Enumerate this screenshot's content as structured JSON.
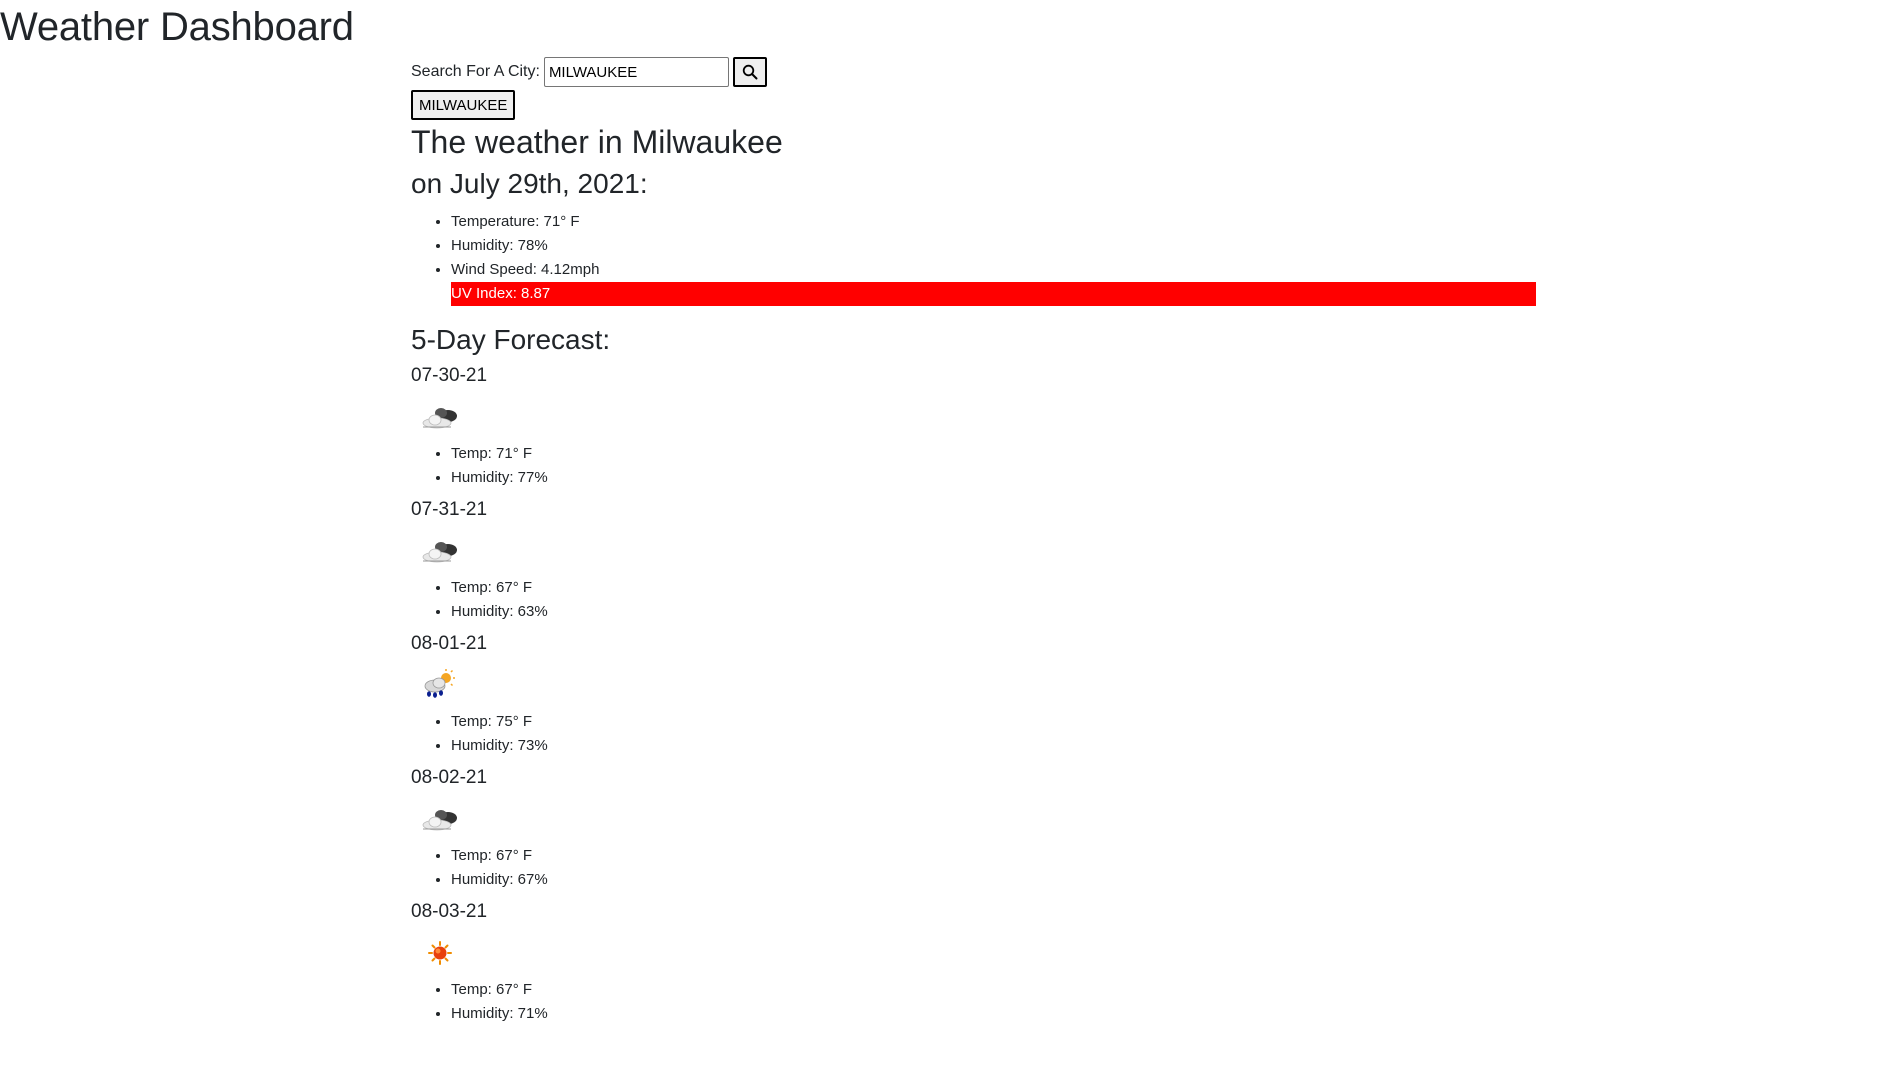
{
  "header": {
    "title": "Weather Dashboard"
  },
  "search": {
    "label": "Search For A City:",
    "value": "MILWAUKEE",
    "button_icon": "search-icon"
  },
  "history": [
    "MILWAUKEE"
  ],
  "current": {
    "title": "The weather in Milwaukee",
    "date": "on July 29th, 2021:",
    "temperature": "Temperature: 71° F",
    "humidity": "Humidity: 78%",
    "wind": "Wind Speed: 4.12mph",
    "uv": "UV Index: 8.87",
    "uv_color": "#ff0000"
  },
  "forecast": {
    "title": "5-Day Forecast:",
    "days": [
      {
        "date": "07-30-21",
        "icon": "cloudy-icon",
        "temp": "Temp: 71° F",
        "humidity": "Humidity: 77%"
      },
      {
        "date": "07-31-21",
        "icon": "cloudy-icon",
        "temp": "Temp: 67° F",
        "humidity": "Humidity: 63%"
      },
      {
        "date": "08-01-21",
        "icon": "rain-sun-icon",
        "temp": "Temp: 75° F",
        "humidity": "Humidity: 73%"
      },
      {
        "date": "08-02-21",
        "icon": "cloudy-icon",
        "temp": "Temp: 67° F",
        "humidity": "Humidity: 67%"
      },
      {
        "date": "08-03-21",
        "icon": "sun-icon",
        "temp": "Temp: 67° F",
        "humidity": "Humidity: 71%"
      }
    ]
  }
}
